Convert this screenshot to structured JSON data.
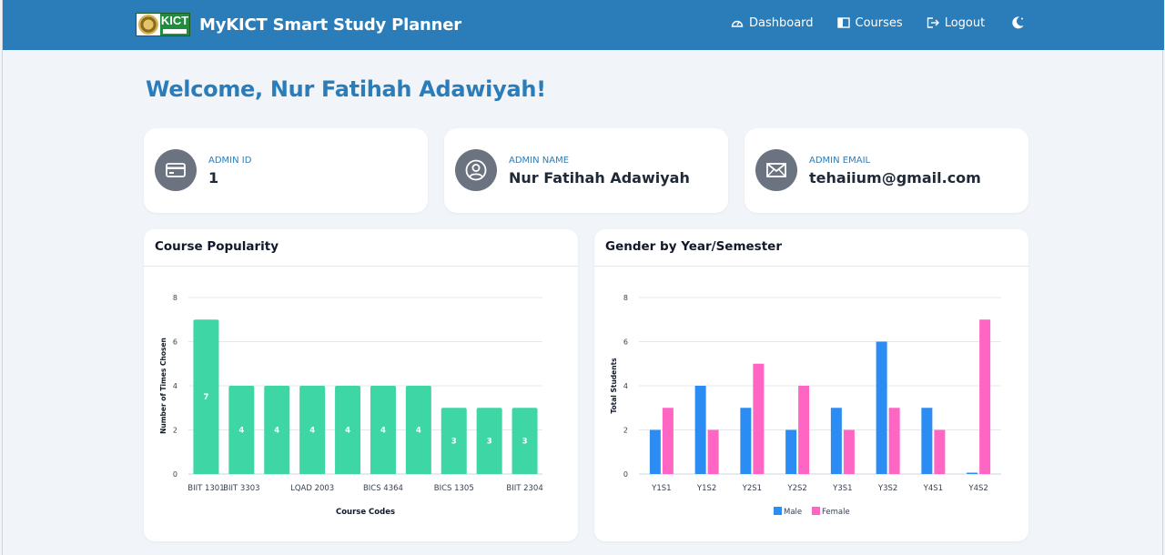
{
  "app": {
    "title": "MyKICT Smart Study Planner",
    "logo_text": "KICT"
  },
  "nav": {
    "dashboard": "Dashboard",
    "courses": "Courses",
    "logout": "Logout",
    "theme_icon": "moon-icon"
  },
  "welcome": "Welcome, Nur Fatihah Adawiyah!",
  "info_cards": [
    {
      "label": "ADMIN ID",
      "value": "1",
      "icon": "id-card-icon"
    },
    {
      "label": "ADMIN NAME",
      "value": "Nur Fatihah Adawiyah",
      "icon": "user-circle-icon"
    },
    {
      "label": "ADMIN EMAIL",
      "value": "tehaiium@gmail.com",
      "icon": "envelope-icon"
    }
  ],
  "charts": {
    "popularity_title": "Course Popularity",
    "gender_title": "Gender by Year/Semester"
  },
  "colors": {
    "navbar": "#2a7db8",
    "accent": "#2a7db8",
    "bar_green": "#3fd6a5",
    "male": "#2b8cf4",
    "female": "#ff66c4"
  },
  "chart_data": [
    {
      "type": "bar",
      "title": "Course Popularity",
      "xlabel": "Course Codes",
      "ylabel": "Number of Times Chosen",
      "ylim": [
        0,
        8
      ],
      "yticks": [
        0,
        2,
        4,
        6,
        8
      ],
      "grid": true,
      "data_labels": true,
      "categories": [
        "BIIT 1301",
        "BIIT 3303",
        "",
        "LQAD 2003",
        "",
        "BICS 4364",
        "",
        "BICS 1305",
        "",
        "BIIT 2304"
      ],
      "values": [
        7,
        4,
        4,
        4,
        4,
        4,
        4,
        3,
        3,
        3
      ]
    },
    {
      "type": "bar",
      "title": "Gender by Year/Semester",
      "xlabel": "",
      "ylabel": "Total Students",
      "ylim": [
        0,
        8
      ],
      "yticks": [
        0,
        2,
        4,
        6,
        8
      ],
      "grid": true,
      "legend": "bottom",
      "categories": [
        "Y1S1",
        "Y1S2",
        "Y2S1",
        "Y2S2",
        "Y3S1",
        "Y3S2",
        "Y4S1",
        "Y4S2"
      ],
      "series": [
        {
          "name": "Male",
          "values": [
            2,
            4,
            3,
            2,
            3,
            6,
            3,
            0
          ]
        },
        {
          "name": "Female",
          "values": [
            3,
            2,
            5,
            4,
            2,
            3,
            2,
            7
          ]
        }
      ]
    }
  ]
}
